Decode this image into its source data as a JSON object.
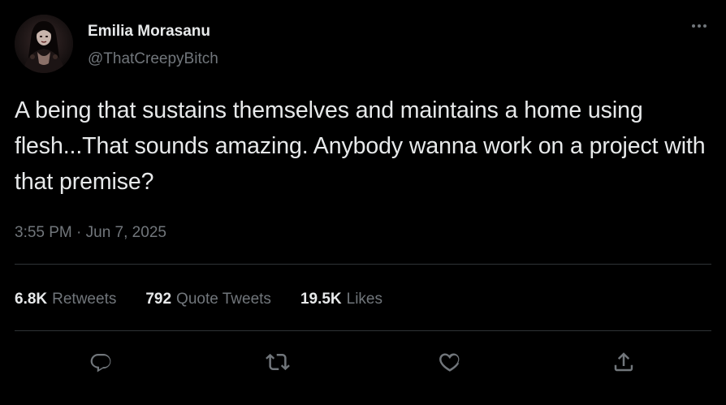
{
  "author": {
    "display_name": "Emilia Morasanu",
    "handle": "@ThatCreepyBitch",
    "avatar_icon": "gothic-portrait-avatar"
  },
  "tweet": {
    "text": "A being that sustains themselves and maintains a home using flesh...That sounds amazing. Anybody wanna work on a project with that premise?",
    "timestamp": "3:55 PM · Jun 7, 2025"
  },
  "stats": {
    "retweets_count": "6.8K",
    "retweets_label": "Retweets",
    "quotes_count": "792",
    "quotes_label": "Quote Tweets",
    "likes_count": "19.5K",
    "likes_label": "Likes"
  },
  "actions": {
    "reply_icon": "reply-icon",
    "retweet_icon": "retweet-icon",
    "like_icon": "heart-icon",
    "share_icon": "share-icon"
  },
  "colors": {
    "background": "#000000",
    "primary_text": "#e7e9ea",
    "secondary_text": "#71767b",
    "divider": "#2f3336"
  }
}
